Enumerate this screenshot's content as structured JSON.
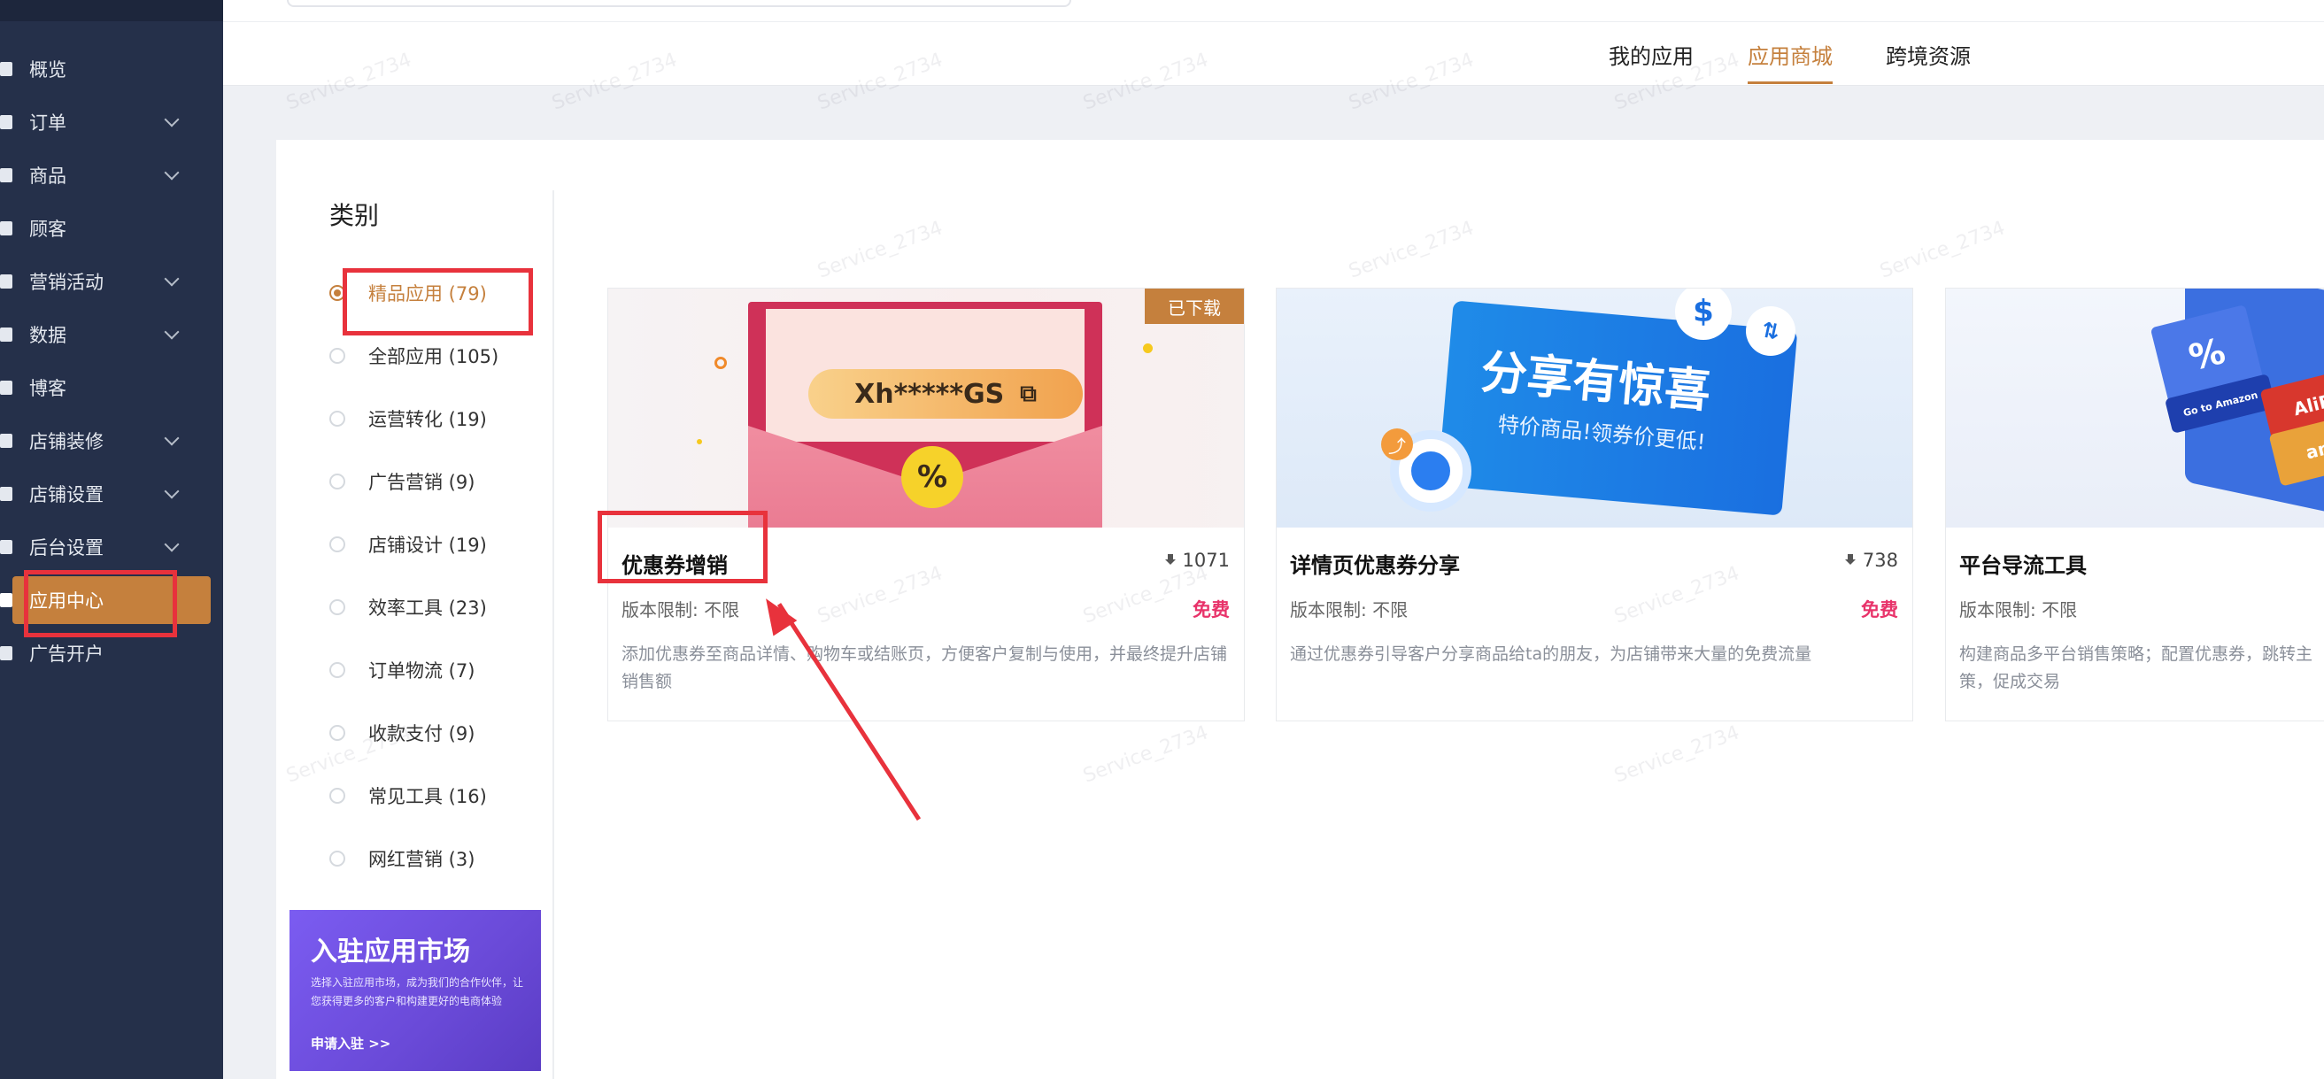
{
  "sidebar": {
    "items": [
      {
        "label": "概览",
        "chevron": false,
        "icon": "overview-icon"
      },
      {
        "label": "订单",
        "chevron": true,
        "icon": "order-icon"
      },
      {
        "label": "商品",
        "chevron": true,
        "icon": "product-icon"
      },
      {
        "label": "顾客",
        "chevron": false,
        "icon": "customer-icon"
      },
      {
        "label": "营销活动",
        "chevron": true,
        "icon": "marketing-icon"
      },
      {
        "label": "数据",
        "chevron": true,
        "icon": "data-icon"
      },
      {
        "label": "博客",
        "chevron": false,
        "icon": "blog-icon"
      },
      {
        "label": "店铺装修",
        "chevron": true,
        "icon": "decorate-icon"
      },
      {
        "label": "店铺设置",
        "chevron": true,
        "icon": "store-settings-icon"
      },
      {
        "label": "后台设置",
        "chevron": true,
        "icon": "admin-settings-icon"
      },
      {
        "label": "应用中心",
        "chevron": false,
        "icon": "app-center-icon",
        "active": true
      },
      {
        "label": "广告开户",
        "chevron": false,
        "icon": "ads-icon"
      }
    ]
  },
  "header": {
    "tabs": [
      {
        "label": "我的应用"
      },
      {
        "label": "应用商城",
        "active": true
      },
      {
        "label": "跨境资源"
      }
    ]
  },
  "categories": {
    "title": "类别",
    "items": [
      {
        "label": "精品应用 (79)",
        "selected": true
      },
      {
        "label": "全部应用 (105)"
      },
      {
        "label": "运营转化 (19)"
      },
      {
        "label": "广告营销 (9)"
      },
      {
        "label": "店铺设计 (19)"
      },
      {
        "label": "效率工具 (23)"
      },
      {
        "label": "订单物流 (7)"
      },
      {
        "label": "收款支付 (9)"
      },
      {
        "label": "常见工具 (16)"
      },
      {
        "label": "网红营销 (3)"
      }
    ]
  },
  "promo": {
    "title": "入驻应用市场",
    "desc": "选择入驻应用市场，成为我们的合作伙伴，让您获得更多的客户和构建更好的电商体验",
    "link": "申请入驻 >>"
  },
  "cards": [
    {
      "title": "优惠券增销",
      "downloads": "1071",
      "limit": "版本限制:  不限",
      "price": "免费",
      "desc": "添加优惠券至商品详情、购物车或结账页，方便客户复制与使用，并最终提升店铺销售额",
      "badge": "已下载",
      "image_code": "Xh*****GS",
      "image_percent": "%"
    },
    {
      "title": "详情页优惠券分享",
      "downloads": "738",
      "limit": "版本限制:  不限",
      "price": "免费",
      "desc": "通过优惠券引导客户分享商品给ta的朋友，为店铺带来大量的免费流量",
      "image_title": "分享有惊喜",
      "image_sub": "特价商品!领券价更低!",
      "image_coin": "$"
    },
    {
      "title": "平台导流工具",
      "limit": "版本限制:  不限",
      "desc": "构建商品多平台销售策略；配置优惠券，跳转主策，促成交易",
      "image_labels": [
        "AliEx",
        "ama",
        "Go to Amazon"
      ]
    }
  ],
  "watermark_text": "Service_2734",
  "colors": {
    "accent": "#c5803d",
    "sidebar": "#25304a",
    "price": "#e8336a",
    "annotation": "#e8323c"
  }
}
